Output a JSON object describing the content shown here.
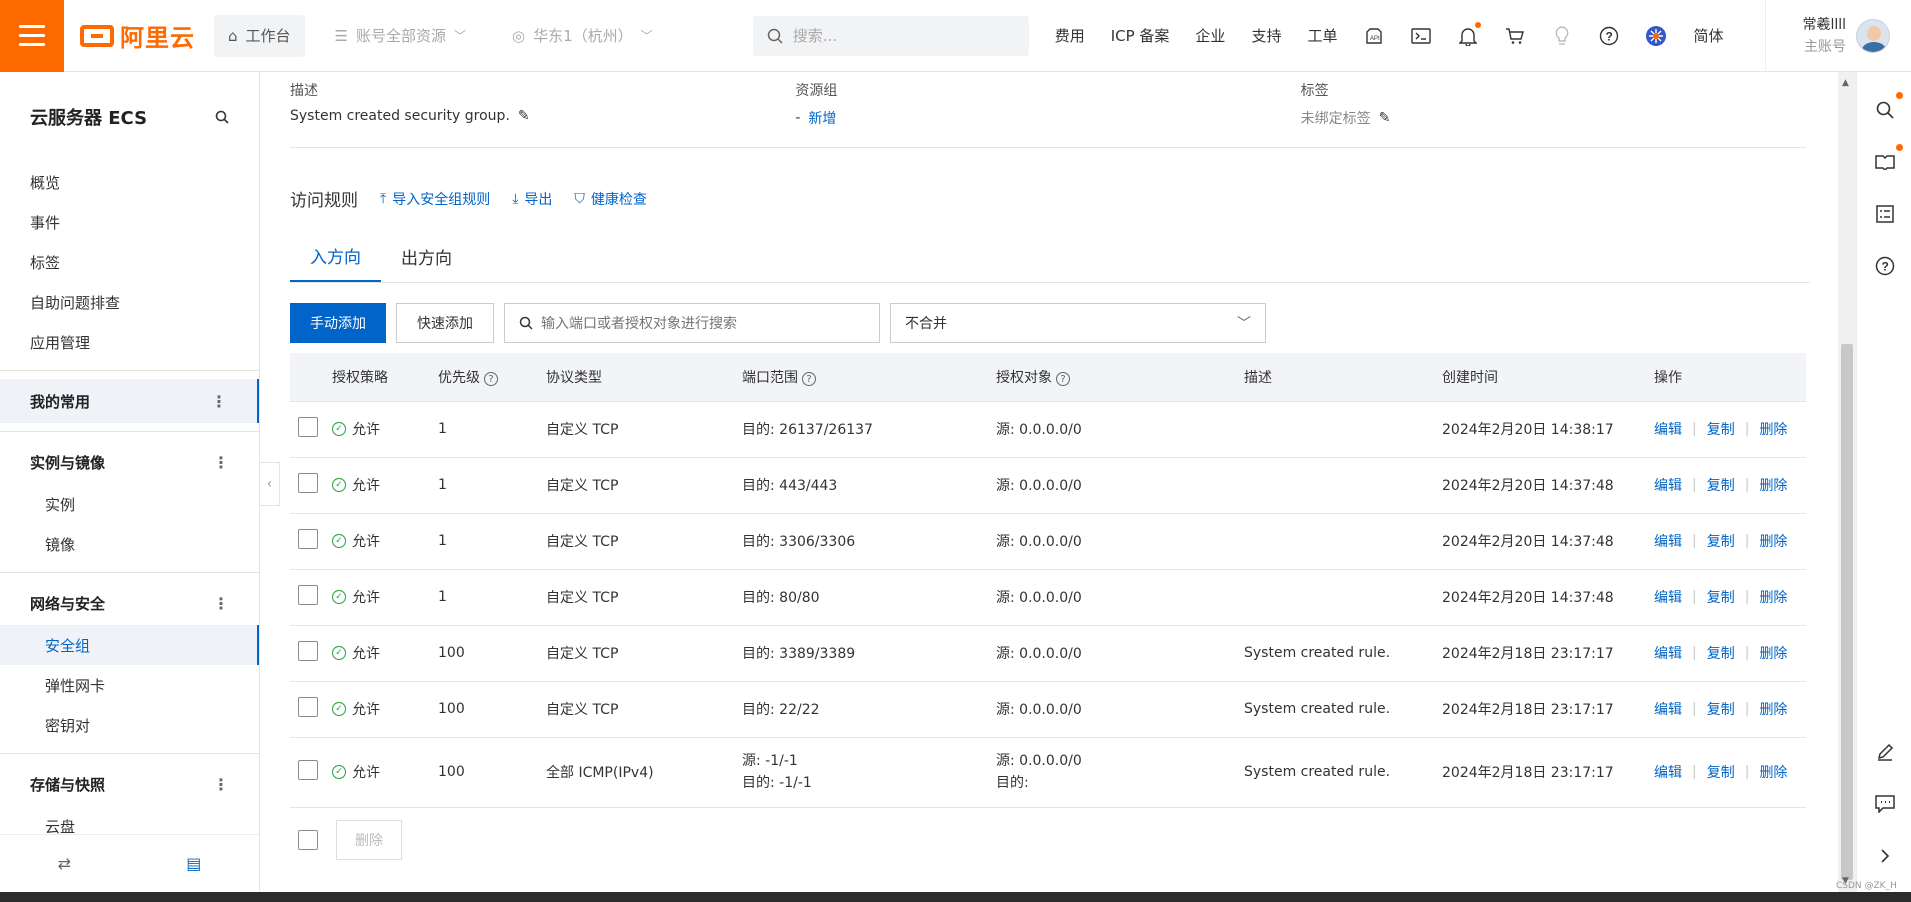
{
  "topbar": {
    "logo_text": "阿里云",
    "workbench": "工作台",
    "resource_scope": "账号全部资源",
    "region": "华东1（杭州）",
    "search_placeholder": "搜索...",
    "links": [
      "费用",
      "ICP 备案",
      "企业",
      "支持",
      "工单"
    ],
    "language": "简体",
    "user_name": "常羲llll",
    "user_role": "主账号"
  },
  "sidebar": {
    "title": "云服务器 ECS",
    "items": [
      "概览",
      "事件",
      "标签",
      "自助问题排查",
      "应用管理"
    ],
    "favorites": "我的常用",
    "group_instances": "实例与镜像",
    "instances_items": [
      "实例",
      "镜像"
    ],
    "group_network": "网络与安全",
    "network_items": [
      "安全组",
      "弹性网卡",
      "密钥对"
    ],
    "group_storage": "存储与快照",
    "storage_items": [
      "云盘"
    ]
  },
  "info": {
    "desc_label": "描述",
    "desc_value": "System created security group.",
    "rg_label": "资源组",
    "rg_dash": "-",
    "rg_add": "新增",
    "tag_label": "标签",
    "tag_value": "未绑定标签"
  },
  "rules": {
    "title": "访问规则",
    "import": "导入安全组规则",
    "export": "导出",
    "health": "健康检查",
    "tab_in": "入方向",
    "tab_out": "出方向",
    "add_manual": "手动添加",
    "add_quick": "快速添加",
    "search_placeholder": "输入端口或者授权对象进行搜索",
    "merge_select": "不合并",
    "delete": "删除"
  },
  "table": {
    "headers": [
      "授权策略",
      "优先级",
      "协议类型",
      "端口范围",
      "授权对象",
      "描述",
      "创建时间",
      "操作"
    ],
    "ops": [
      "编辑",
      "复制",
      "删除"
    ],
    "rows": [
      {
        "policy": "允许",
        "priority": "1",
        "protocol": "自定义 TCP",
        "port": "目的: 26137/26137",
        "object": "源: 0.0.0.0/0",
        "desc": "",
        "time": "2024年2月20日 14:38:17"
      },
      {
        "policy": "允许",
        "priority": "1",
        "protocol": "自定义 TCP",
        "port": "目的: 443/443",
        "object": "源: 0.0.0.0/0",
        "desc": "",
        "time": "2024年2月20日 14:37:48"
      },
      {
        "policy": "允许",
        "priority": "1",
        "protocol": "自定义 TCP",
        "port": "目的: 3306/3306",
        "object": "源: 0.0.0.0/0",
        "desc": "",
        "time": "2024年2月20日 14:37:48"
      },
      {
        "policy": "允许",
        "priority": "1",
        "protocol": "自定义 TCP",
        "port": "目的: 80/80",
        "object": "源: 0.0.0.0/0",
        "desc": "",
        "time": "2024年2月20日 14:37:48"
      },
      {
        "policy": "允许",
        "priority": "100",
        "protocol": "自定义 TCP",
        "port": "目的: 3389/3389",
        "object": "源: 0.0.0.0/0",
        "desc": "System created rule.",
        "time": "2024年2月18日 23:17:17"
      },
      {
        "policy": "允许",
        "priority": "100",
        "protocol": "自定义 TCP",
        "port": "目的: 22/22",
        "object": "源: 0.0.0.0/0",
        "desc": "System created rule.",
        "time": "2024年2月18日 23:17:17"
      },
      {
        "policy": "允许",
        "priority": "100",
        "protocol": "全部 ICMP(IPv4)",
        "port": "源: -1/-1",
        "port2": "目的: -1/-1",
        "object": "源: 0.0.0.0/0",
        "object2": "目的:",
        "desc": "System created rule.",
        "time": "2024年2月18日 23:17:17"
      }
    ]
  },
  "watermark": "CSDN @ZK_H"
}
